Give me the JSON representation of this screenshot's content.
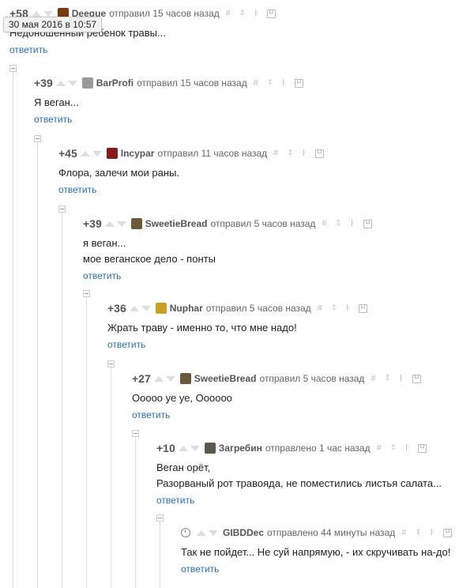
{
  "tooltip": "30 мая 2016 в 10:57",
  "reply_label": "ответить",
  "comments": [
    {
      "rating": "+58",
      "author": "Deegue",
      "time": "отправил 15 часов назад",
      "lines": [
        "Недоношенный ребенок травы..."
      ],
      "avatar_color": "#7a3a10"
    },
    {
      "rating": "+39",
      "author": "BarProfi",
      "time": "отправил 15 часов назад",
      "lines": [
        "Я веган..."
      ],
      "avatar_color": "#9a9a9a"
    },
    {
      "rating": "+45",
      "author": "Incypar",
      "time": "отправил 11 часов назад",
      "lines": [
        "Флора, залечи мои раны."
      ],
      "avatar_color": "#8a1a1a"
    },
    {
      "rating": "+39",
      "author": "SweetieBread",
      "time": "отправил 5 часов назад",
      "lines": [
        "я веган...",
        "мое веганское дело - понты"
      ],
      "avatar_color": "#6b5a3a"
    },
    {
      "rating": "+36",
      "author": "Nuphar",
      "time": "отправил 5 часов назад",
      "lines": [
        "Жрать траву - именно то, что мне надо!"
      ],
      "avatar_color": "#c9a020"
    },
    {
      "rating": "+27",
      "author": "SweetieBread",
      "time": "отправил 5 часов назад",
      "lines": [
        "Ооооо уе уе, Оооооо"
      ],
      "avatar_color": "#6b5a3a"
    },
    {
      "rating": "+10",
      "author": "Загребин",
      "time": "отправлено 1 час назад",
      "lines": [
        "Веган орёт,",
        "Разорваный рот травояда, не поместились листья салата..."
      ],
      "avatar_color": "#5a5a4a"
    },
    {
      "rating": "",
      "author": "GIBDDec",
      "time": "отправлено 44 минуты назад",
      "lines": [
        "Так не пойдет... Не суй напрямую, - их скручивать на-до!"
      ],
      "avatar_color": ""
    }
  ]
}
